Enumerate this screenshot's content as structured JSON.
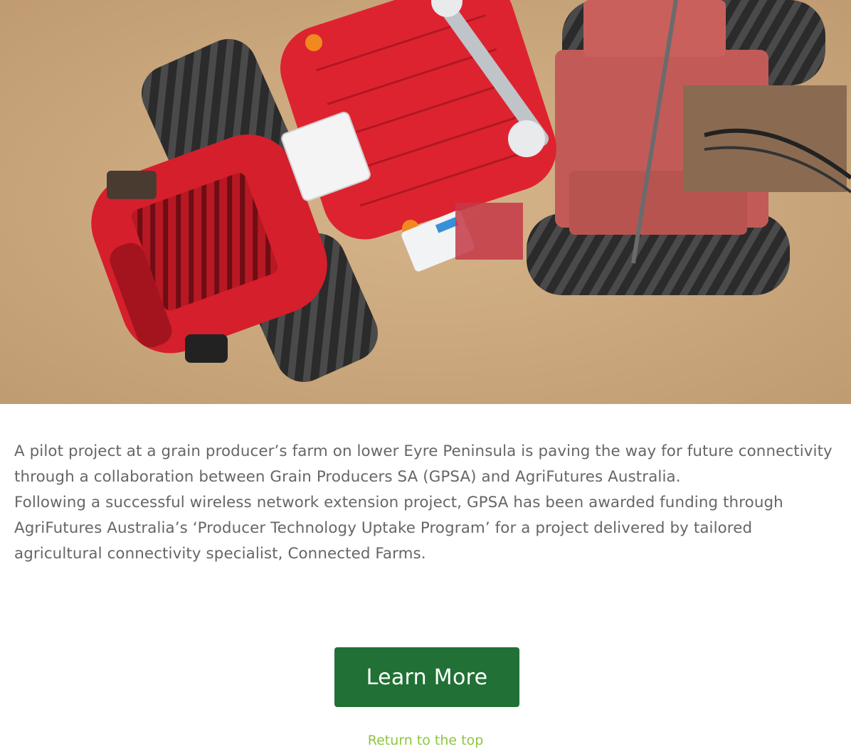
{
  "hero": {
    "image": "aerial-red-tractor-photo"
  },
  "article": {
    "paragraphs": [
      "A pilot project at a grain producer’s farm on lower Eyre Peninsula is paving the way for future connectivity through a collaboration between Grain Producers SA (GPSA) and AgriFutures Australia.",
      "Following a successful wireless network extension project, GPSA has been awarded funding through AgriFutures Australia’s ‘Producer Technology Uptake Program’ for a project delivered by tailored agricultural connectivity specialist, Connected Farms."
    ]
  },
  "cta": {
    "label": "Learn More"
  },
  "footer": {
    "return_top": "Return to the top"
  },
  "colors": {
    "text": "#666666",
    "button_bg": "#217035",
    "button_text": "#ffffff",
    "link": "#8dc63f",
    "tractor_red": "#d8202e",
    "soil": "#c9a478"
  }
}
